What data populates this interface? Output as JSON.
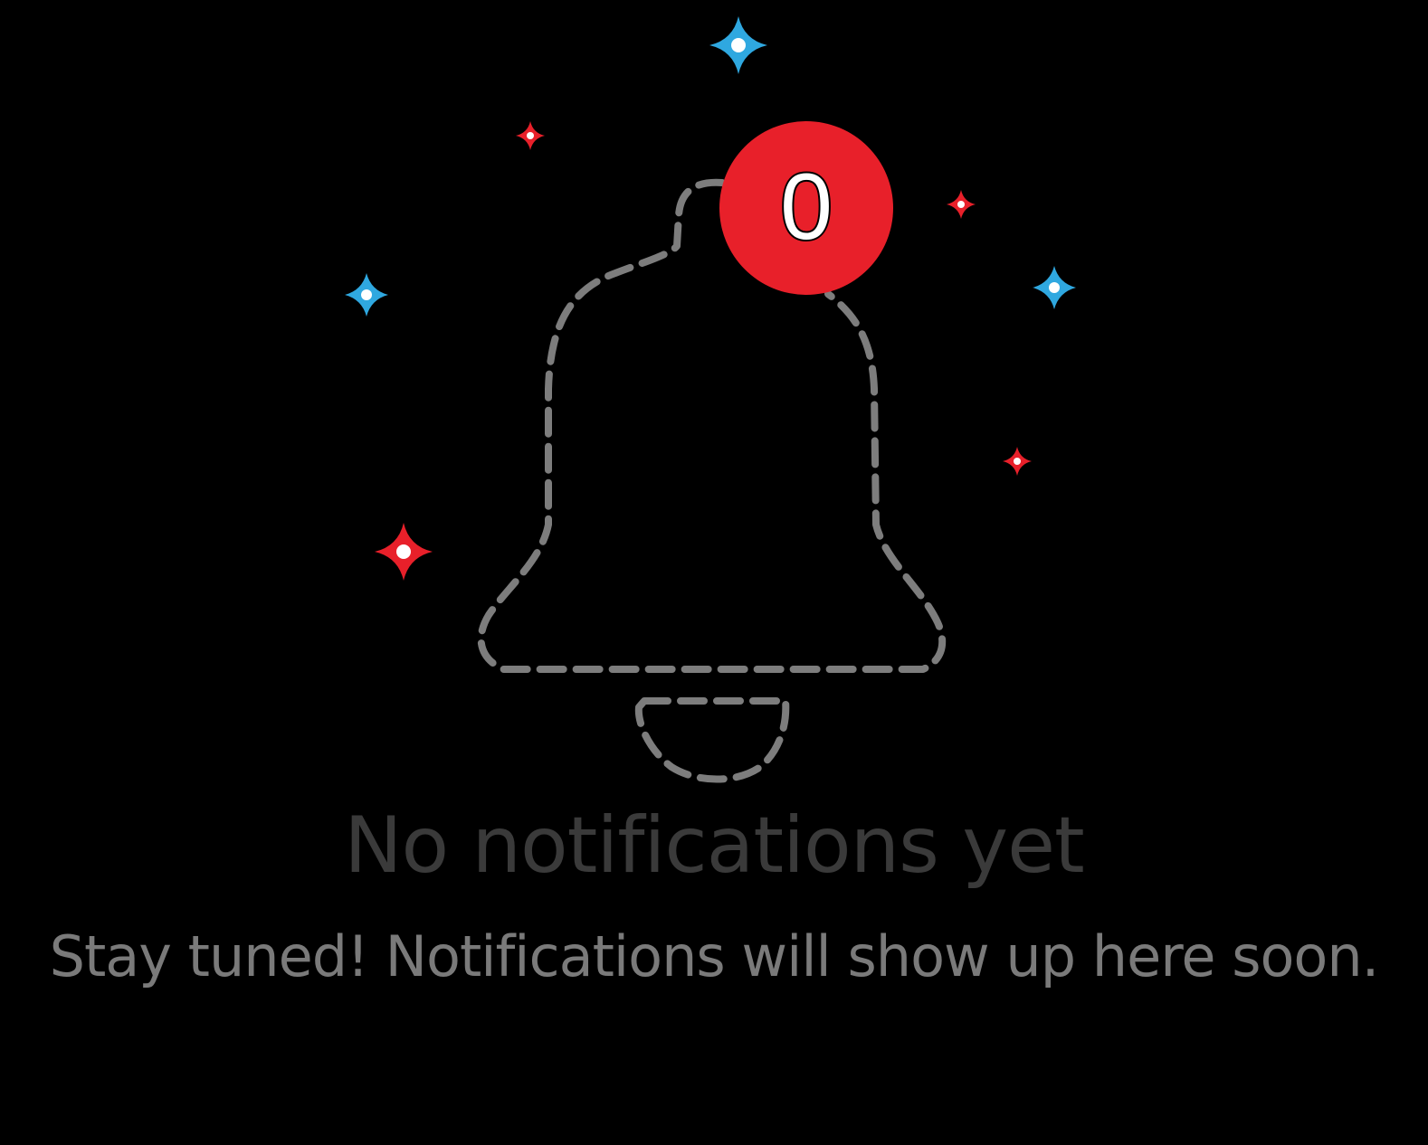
{
  "empty_state": {
    "badge_count": "0",
    "title": "No notifications yet",
    "message": "Stay tuned! Notifications will show up here soon."
  },
  "icons": {
    "bell": "bell-outline-icon",
    "badge": "notification-count-badge",
    "sparkle": "sparkle-icon"
  },
  "colors": {
    "background": "#000000",
    "bell_outline": "#7d7d7d",
    "badge_fill": "#e8202a",
    "badge_text": "#ffffff",
    "sparkle_red": "#e8202a",
    "sparkle_blue": "#2fa8e0",
    "title": "#3a3a3a",
    "message": "#7a7a7a"
  }
}
